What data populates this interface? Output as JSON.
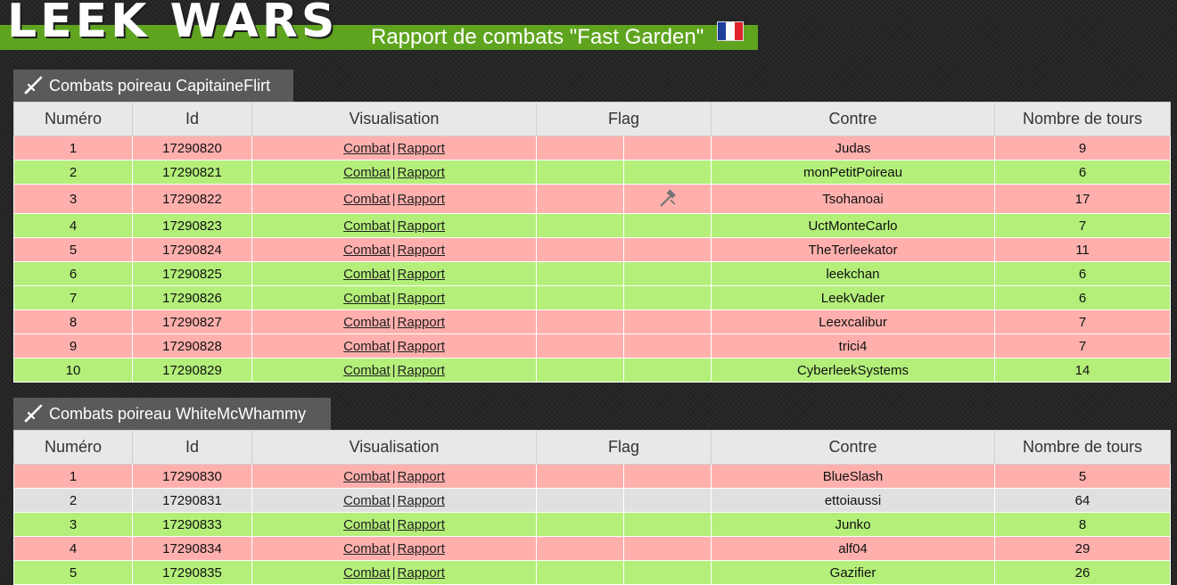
{
  "header": {
    "logo_text": "LEEK WARS",
    "title": "Rapport de combats \"Fast Garden\"",
    "flag_icon": "france-flag-icon"
  },
  "columns": [
    "Numéro",
    "Id",
    "Visualisation",
    "Flag",
    "Contre",
    "Nombre de tours"
  ],
  "links": {
    "combat": "Combat",
    "separator": "|",
    "rapport": "Rapport"
  },
  "sections": [
    {
      "title": "Combats poireau CapitaineFlirt",
      "rows": [
        {
          "num": "1",
          "id": "17290820",
          "flag": "",
          "opponent": "Judas",
          "turns": "9",
          "result": "loss"
        },
        {
          "num": "2",
          "id": "17290821",
          "flag": "",
          "opponent": "monPetitPoireau",
          "turns": "6",
          "result": "win"
        },
        {
          "num": "3",
          "id": "17290822",
          "flag": "hammer-icon",
          "opponent": "Tsohanoai",
          "turns": "17",
          "result": "loss"
        },
        {
          "num": "4",
          "id": "17290823",
          "flag": "",
          "opponent": "UctMonteCarlo",
          "turns": "7",
          "result": "win"
        },
        {
          "num": "5",
          "id": "17290824",
          "flag": "",
          "opponent": "TheTerleekator",
          "turns": "11",
          "result": "loss"
        },
        {
          "num": "6",
          "id": "17290825",
          "flag": "",
          "opponent": "leekchan",
          "turns": "6",
          "result": "win"
        },
        {
          "num": "7",
          "id": "17290826",
          "flag": "",
          "opponent": "LeekVader",
          "turns": "6",
          "result": "win"
        },
        {
          "num": "8",
          "id": "17290827",
          "flag": "",
          "opponent": "Leexcalibur",
          "turns": "7",
          "result": "loss"
        },
        {
          "num": "9",
          "id": "17290828",
          "flag": "",
          "opponent": "trici4",
          "turns": "7",
          "result": "loss"
        },
        {
          "num": "10",
          "id": "17290829",
          "flag": "",
          "opponent": "CyberleekSystems",
          "turns": "14",
          "result": "win"
        }
      ]
    },
    {
      "title": "Combats poireau WhiteMcWhammy",
      "rows": [
        {
          "num": "1",
          "id": "17290830",
          "flag": "",
          "opponent": "BlueSlash",
          "turns": "5",
          "result": "loss"
        },
        {
          "num": "2",
          "id": "17290831",
          "flag": "",
          "opponent": "ettoiaussi",
          "turns": "64",
          "result": "draw"
        },
        {
          "num": "3",
          "id": "17290833",
          "flag": "",
          "opponent": "Junko",
          "turns": "8",
          "result": "win"
        },
        {
          "num": "4",
          "id": "17290834",
          "flag": "",
          "opponent": "alf04",
          "turns": "29",
          "result": "loss"
        },
        {
          "num": "5",
          "id": "17290835",
          "flag": "",
          "opponent": "Gazifier",
          "turns": "26",
          "result": "win"
        }
      ]
    }
  ],
  "colors": {
    "loss": "#ffb0ad",
    "win": "#b4ef7a",
    "draw": "#e0e0e0",
    "brand_green": "#5fa41f"
  }
}
